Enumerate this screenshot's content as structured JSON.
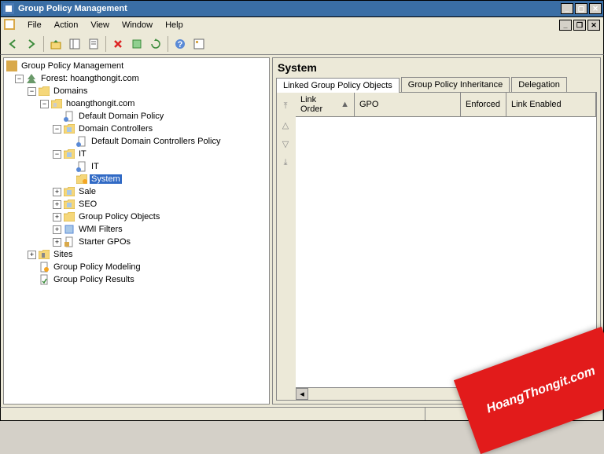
{
  "window": {
    "title": "Group Policy Management"
  },
  "menu": {
    "file": "File",
    "action": "Action",
    "view": "View",
    "window": "Window",
    "help": "Help"
  },
  "tree": {
    "root": "Group Policy Management",
    "forest": "Forest: hoangthongit.com",
    "domains": "Domains",
    "domain": "hoangthongit.com",
    "def_domain_policy": "Default Domain Policy",
    "domain_controllers": "Domain Controllers",
    "def_dc_policy": "Default Domain Controllers Policy",
    "it": "IT",
    "it_sub": "IT",
    "system": "System",
    "sale": "Sale",
    "seo": "SEO",
    "gpo": "Group Policy Objects",
    "wmi": "WMI Filters",
    "starter": "Starter GPOs",
    "sites": "Sites",
    "modeling": "Group Policy Modeling",
    "results": "Group Policy Results"
  },
  "details": {
    "title": "System",
    "tabs": {
      "linked": "Linked Group Policy Objects",
      "inheritance": "Group Policy Inheritance",
      "delegation": "Delegation"
    },
    "columns": {
      "link_order": "Link Order",
      "gpo": "GPO",
      "enforced": "Enforced",
      "link_enabled": "Link Enabled"
    }
  },
  "watermark": "HoangThongit.com"
}
